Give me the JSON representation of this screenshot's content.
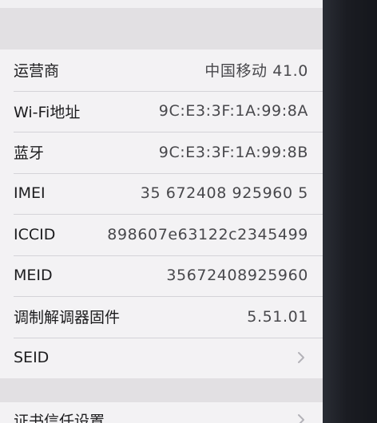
{
  "rows": [
    {
      "label": "运营商",
      "value": "中国移动 41.0"
    },
    {
      "label": "Wi-Fi地址",
      "value": "9C:E3:3F:1A:99:8A"
    },
    {
      "label": "蓝牙",
      "value": "9C:E3:3F:1A:99:8B"
    },
    {
      "label": "IMEI",
      "value": "35 672408 925960 5"
    },
    {
      "label": "ICCID",
      "value": "898607e63122c2345499"
    },
    {
      "label": "MEID",
      "value": "35672408925960"
    },
    {
      "label": "调制解调器固件",
      "value": "5.51.01"
    },
    {
      "label": "SEID"
    }
  ],
  "next_section": {
    "label": "证书信任设置"
  },
  "icons": {
    "disclosure": "chevron-right-icon"
  }
}
